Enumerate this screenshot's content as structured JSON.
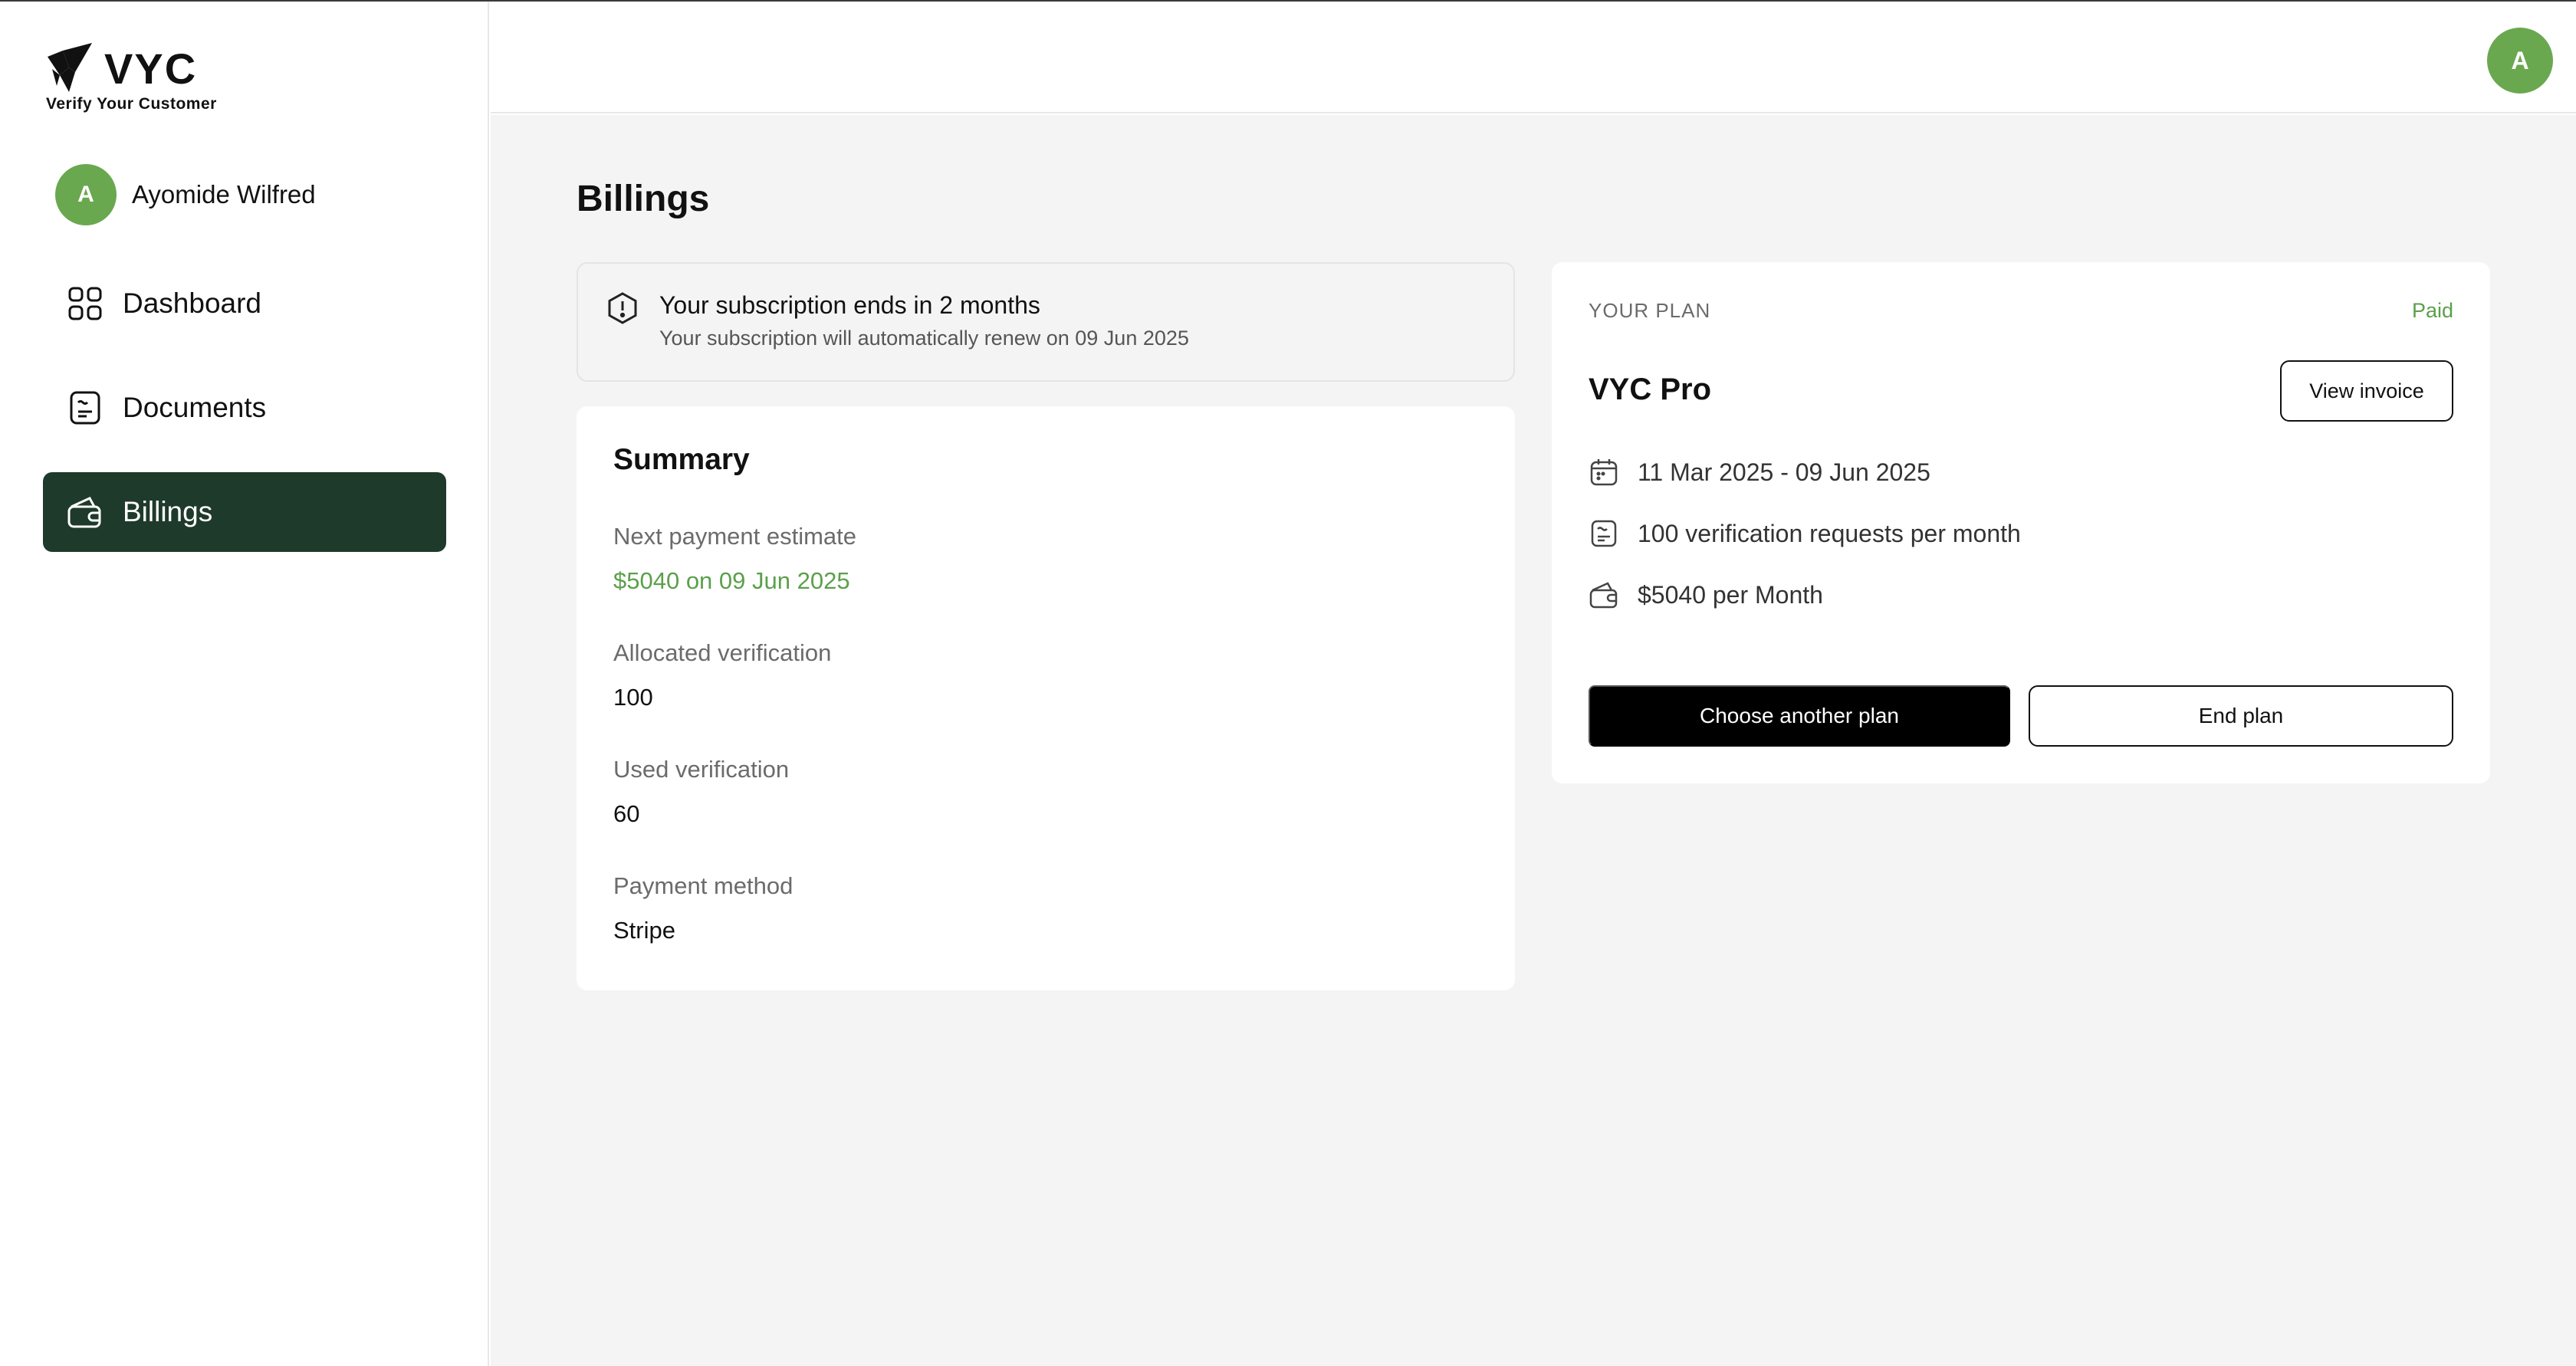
{
  "brand": {
    "name": "VYC",
    "tagline": "Verify Your Customer"
  },
  "user": {
    "initial": "A",
    "name": "Ayomide Wilfred"
  },
  "sidebar": {
    "items": [
      {
        "label": "Dashboard",
        "icon": "dashboard-grid-icon",
        "active": false
      },
      {
        "label": "Documents",
        "icon": "document-icon",
        "active": false
      },
      {
        "label": "Billings",
        "icon": "wallet-icon",
        "active": true
      }
    ]
  },
  "topbar": {
    "avatar_initial": "A"
  },
  "page": {
    "title": "Billings"
  },
  "notice": {
    "icon": "alert-hexagon-icon",
    "title": "Your subscription ends in 2 months",
    "subtitle": "Your subscription will automatically renew on 09 Jun 2025"
  },
  "summary": {
    "title": "Summary",
    "fields": [
      {
        "label": "Next payment estimate",
        "value": "$5040 on 09 Jun 2025",
        "highlight": true
      },
      {
        "label": "Allocated verification",
        "value": "100",
        "highlight": false
      },
      {
        "label": "Used verification",
        "value": "60",
        "highlight": false
      },
      {
        "label": "Payment method",
        "value": "Stripe",
        "highlight": false
      }
    ]
  },
  "plan": {
    "label": "YOUR PLAN",
    "status": "Paid",
    "name": "VYC Pro",
    "view_invoice_label": "View invoice",
    "details": [
      {
        "icon": "calendar-icon",
        "text": "11 Mar 2025 - 09 Jun 2025"
      },
      {
        "icon": "document-icon",
        "text": "100 verification requests per month"
      },
      {
        "icon": "wallet-icon",
        "text": "$5040 per Month"
      }
    ],
    "choose_label": "Choose another plan",
    "end_label": "End plan"
  },
  "colors": {
    "accent_green": "#6aa84f",
    "active_nav": "#1e3a2a",
    "highlight_text": "#5aa04a",
    "background": "#f3f4f3"
  }
}
